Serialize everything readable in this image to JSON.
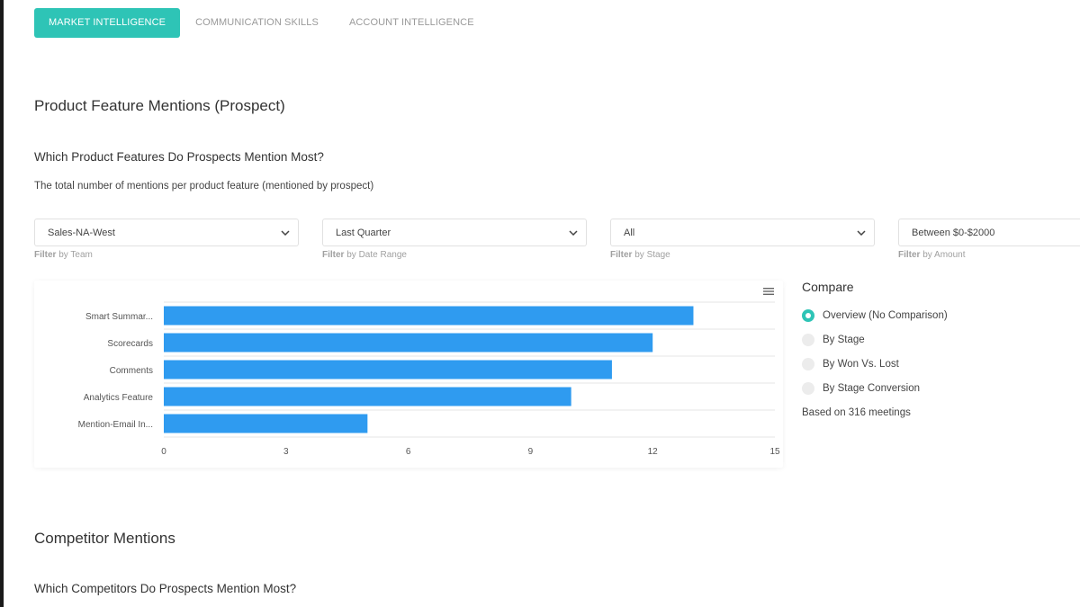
{
  "tabs": [
    {
      "label": "MARKET INTELLIGENCE",
      "active": true
    },
    {
      "label": "COMMUNICATION SKILLS",
      "active": false
    },
    {
      "label": "ACCOUNT INTELLIGENCE",
      "active": false
    }
  ],
  "product_section": {
    "title": "Product Feature Mentions (Prospect)",
    "question": "Which Product Features Do Prospects Mention Most?",
    "description": "The total number of mentions per product feature (mentioned by prospect)"
  },
  "filters": [
    {
      "value": "Sales-NA-West",
      "label_prefix": "Filter",
      "label_suffix": " by Team"
    },
    {
      "value": "Last Quarter",
      "label_prefix": "Filter",
      "label_suffix": " by Date Range"
    },
    {
      "value": "All",
      "label_prefix": "Filter",
      "label_suffix": " by Stage"
    },
    {
      "value": "Between $0-$2000",
      "label_prefix": "Filter",
      "label_suffix": " by Amount"
    }
  ],
  "compare": {
    "title": "Compare",
    "options": [
      {
        "label": "Overview (No Comparison)",
        "checked": true
      },
      {
        "label": "By Stage",
        "checked": false
      },
      {
        "label": "By Won Vs. Lost",
        "checked": false
      },
      {
        "label": "By Stage Conversion",
        "checked": false
      }
    ],
    "based_on": "Based on 316 meetings"
  },
  "competitor_section": {
    "title": "Competitor Mentions",
    "question": "Which Competitors Do Prospects Mention Most?"
  },
  "colors": {
    "accent": "#2ec4b6",
    "bar": "#2f9bf0"
  },
  "chart_data": {
    "type": "bar",
    "orientation": "horizontal",
    "categories": [
      "Smart Summar...",
      "Scorecards",
      "Comments",
      "Analytics Feature",
      "Mention-Email In..."
    ],
    "values": [
      13,
      12,
      11,
      10,
      5
    ],
    "xlim": [
      0,
      15
    ],
    "xticks": [
      0,
      3,
      6,
      9,
      12,
      15
    ],
    "grid": true
  }
}
